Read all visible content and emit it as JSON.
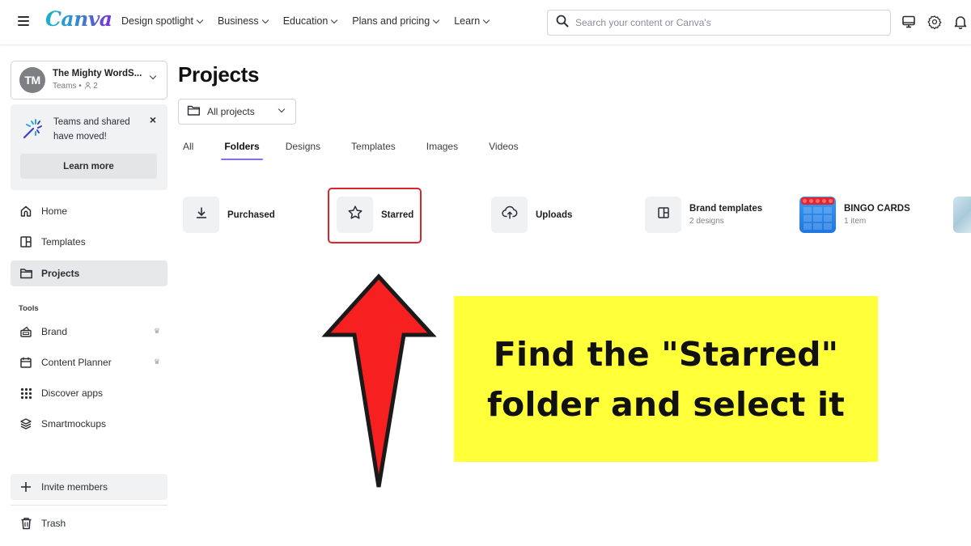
{
  "topbar": {
    "logo": "Canva",
    "nav": [
      {
        "label": "Design spotlight"
      },
      {
        "label": "Business"
      },
      {
        "label": "Education"
      },
      {
        "label": "Plans and pricing"
      },
      {
        "label": "Learn"
      }
    ],
    "search_placeholder": "Search your content or Canva's",
    "icons": [
      "desktop-icon",
      "gear-icon",
      "bell-icon"
    ]
  },
  "sidebar": {
    "team": {
      "initials": "TM",
      "name": "The Mighty WordS...",
      "type": "Teams",
      "members": "2"
    },
    "promo": {
      "text": "Teams and shared have moved!",
      "button": "Learn more",
      "close": "×"
    },
    "items": [
      {
        "label": "Home",
        "icon": "home-icon"
      },
      {
        "label": "Templates",
        "icon": "templates-icon"
      },
      {
        "label": "Projects",
        "icon": "folder-icon",
        "active": true
      }
    ],
    "tools_label": "Tools",
    "tools": [
      {
        "label": "Brand",
        "icon": "brand-kit-icon",
        "premium": true
      },
      {
        "label": "Content Planner",
        "icon": "calendar-icon",
        "premium": true
      },
      {
        "label": "Discover apps",
        "icon": "apps-grid-icon"
      },
      {
        "label": "Smartmockups",
        "icon": "layers-icon"
      }
    ],
    "invite": "Invite members",
    "trash": "Trash",
    "crown": "♛"
  },
  "main": {
    "title": "Projects",
    "project_filter": "All projects",
    "tabs": [
      {
        "label": "All"
      },
      {
        "label": "Folders",
        "active": true
      },
      {
        "label": "Designs"
      },
      {
        "label": "Templates"
      },
      {
        "label": "Images"
      },
      {
        "label": "Videos"
      }
    ],
    "folders": [
      {
        "name": "Purchased",
        "icon": "download-icon"
      },
      {
        "name": "Starred",
        "icon": "star-icon",
        "highlighted": true
      },
      {
        "name": "Uploads",
        "icon": "cloud-upload-icon"
      },
      {
        "name": "Brand templates",
        "sub": "2 designs",
        "icon": "templates-icon"
      },
      {
        "name": "BINGO CARDS",
        "sub": "1 item",
        "icon": "bingo-thumbnail"
      }
    ]
  },
  "annotation": {
    "callout_line1": "Find the \"Starred\"",
    "callout_line2": "folder and select it",
    "arrow_color": "#f5201f",
    "callout_color": "#ffff3a",
    "highlight_color": "#d7262e"
  },
  "colors": {
    "tab_underline": "#8b6cf0",
    "active_nav_bg": "#e6e8ea"
  }
}
